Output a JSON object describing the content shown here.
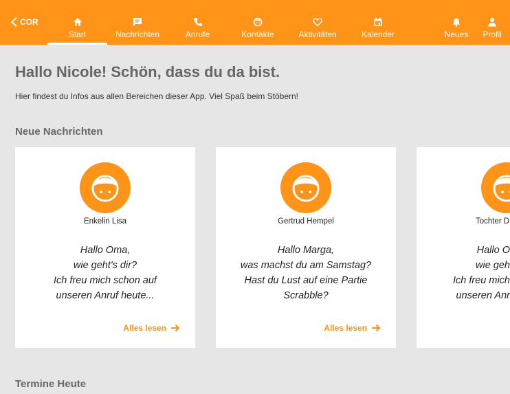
{
  "nav": {
    "back_label": "COR",
    "items": [
      {
        "label": "Start",
        "icon": "home-icon"
      },
      {
        "label": "Nachrichten",
        "icon": "message-icon"
      },
      {
        "label": "Anrufe",
        "icon": "phone-icon"
      },
      {
        "label": "Kontakte",
        "icon": "contact-face-icon"
      },
      {
        "label": "Aktivitäten",
        "icon": "heart-icon"
      },
      {
        "label": "Kalender",
        "icon": "calendar-icon"
      },
      {
        "label": "Neues",
        "icon": "bell-icon"
      },
      {
        "label": "Profil",
        "icon": "person-icon"
      }
    ],
    "active": "Start"
  },
  "colors": {
    "accent": "#ff9418",
    "background": "#e6e6e6"
  },
  "greeting": "Hallo Nicole! Schön, dass du da bist.",
  "intro": "Hier findest du Infos aus allen Bereichen dieser App. Viel Spaß beim Stöbern!",
  "messages_section": {
    "title": "Neue Nachrichten",
    "cards": [
      {
        "sender": "Enkelin Lisa",
        "lines": [
          "Hallo Oma,",
          "wie geht's dir?",
          "Ich freu mich schon auf",
          "unseren Anruf heute..."
        ],
        "link": "Alles lesen"
      },
      {
        "sender": "Gertrud Hempel",
        "lines": [
          "Hallo Marga,",
          "was machst du am Samstag?",
          "Hast du Lust auf eine Partie",
          "Scrabble?"
        ],
        "link": "Alles lesen"
      },
      {
        "sender": "Tochter D",
        "lines": [
          "Hallo O",
          "wie geh",
          "Ich freu mich",
          "unseren Anr"
        ],
        "link": ""
      }
    ]
  },
  "appointments_section": {
    "title": "Termine Heute"
  }
}
